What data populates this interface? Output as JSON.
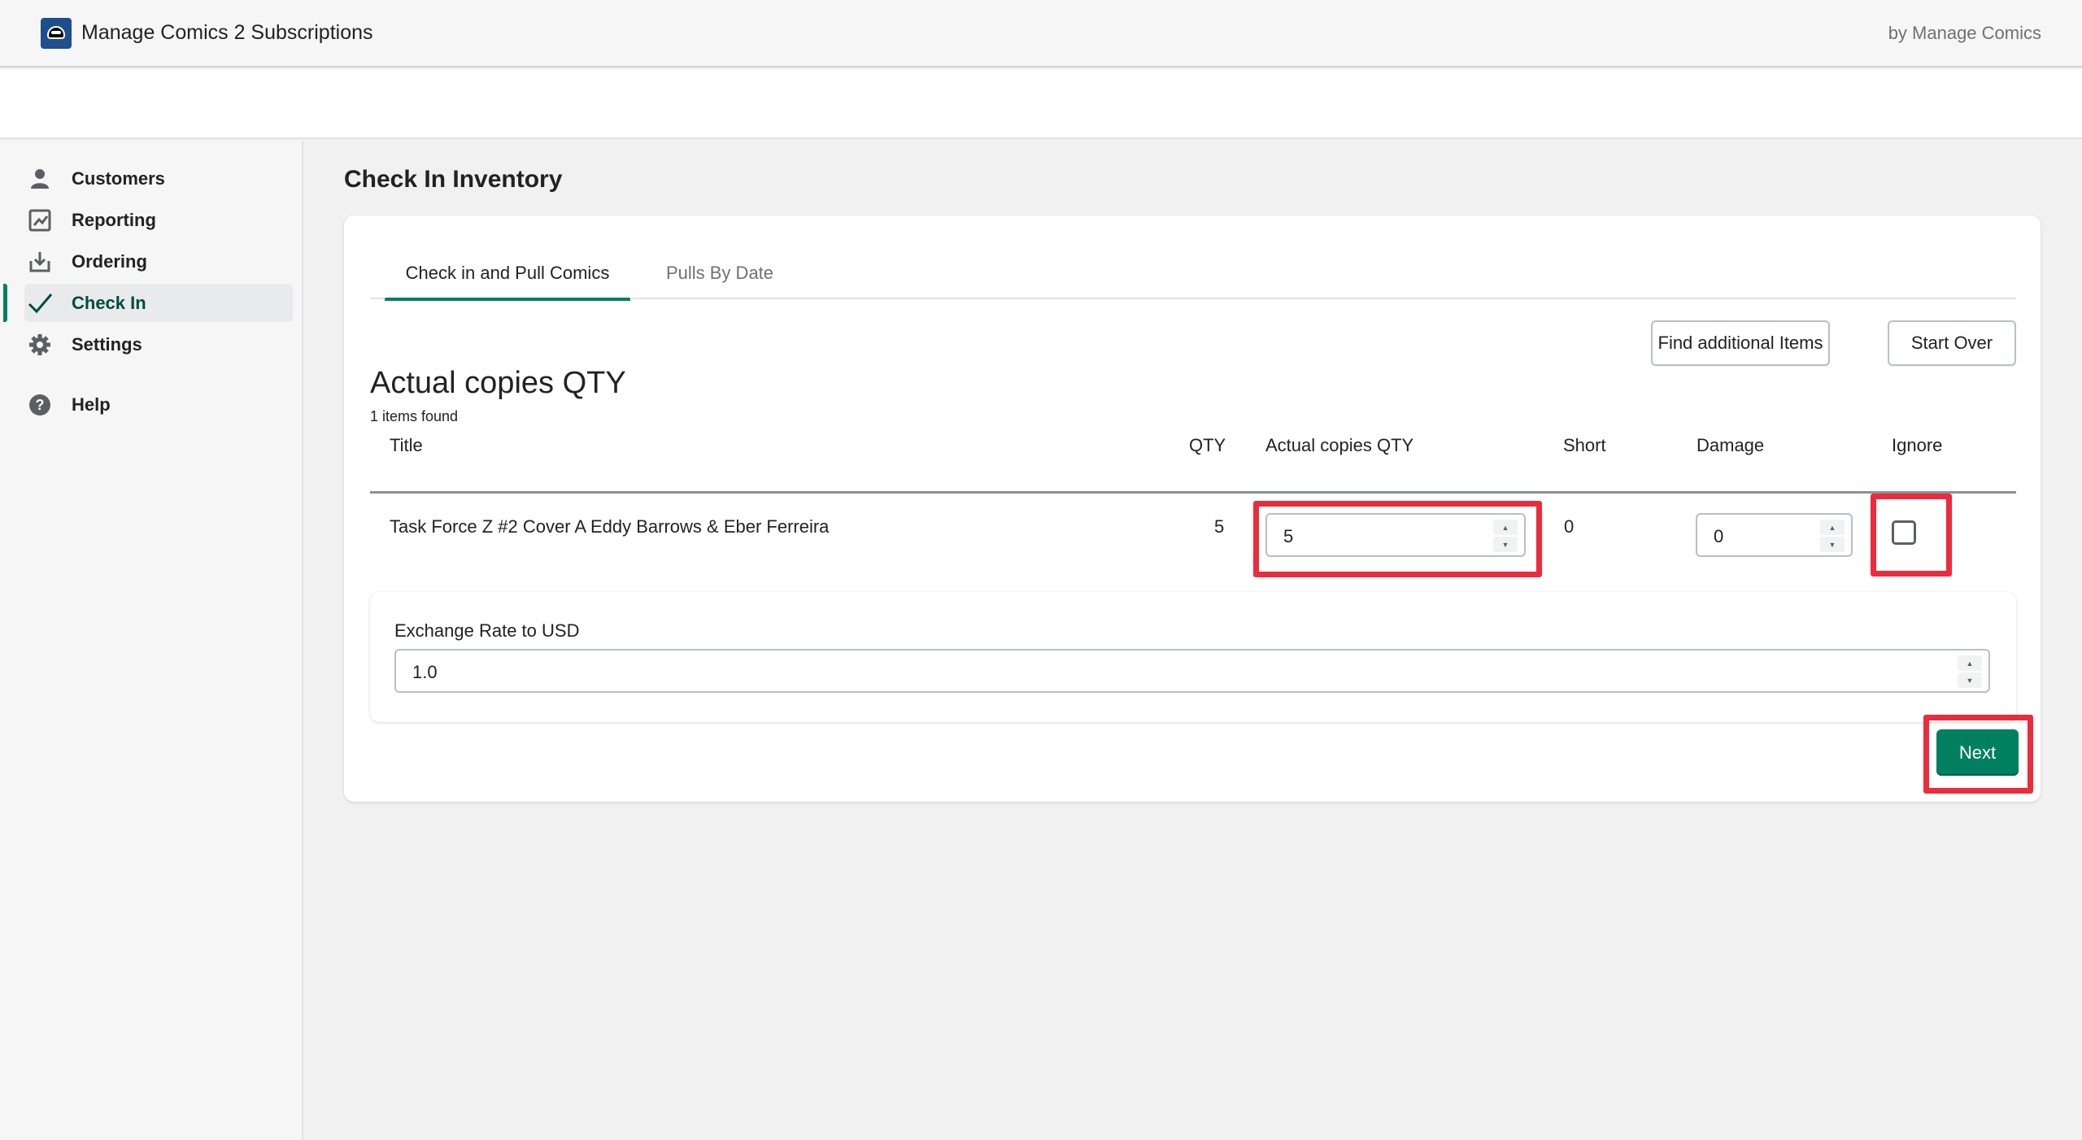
{
  "header": {
    "app_title": "Manage Comics 2 Subscriptions",
    "by_label": "by Manage Comics",
    "icon": "comic-mask-icon"
  },
  "sidebar": {
    "items": [
      {
        "label": "Customers",
        "icon": "person-icon"
      },
      {
        "label": "Reporting",
        "icon": "reporting-icon"
      },
      {
        "label": "Ordering",
        "icon": "download-tray-icon"
      },
      {
        "label": "Check In",
        "icon": "checkmark-icon",
        "active": true
      },
      {
        "label": "Settings",
        "icon": "gear-icon"
      },
      {
        "label": "Help",
        "icon": "question-circle-icon"
      }
    ]
  },
  "page": {
    "title": "Check In Inventory"
  },
  "tabs": [
    {
      "label": "Check in and Pull Comics",
      "active": true
    },
    {
      "label": "Pulls By Date",
      "active": false
    }
  ],
  "actions": {
    "find_label": "Find additional Items",
    "start_over_label": "Start Over",
    "next_label": "Next"
  },
  "section": {
    "title": "Actual copies QTY",
    "items_found": "1 items found"
  },
  "table": {
    "columns": [
      "Title",
      "QTY",
      "Actual copies QTY",
      "Short",
      "Damage",
      "Ignore"
    ],
    "rows": [
      {
        "title": "Task Force Z #2 Cover A Eddy Barrows & Eber Ferreira",
        "qty": "5",
        "actual_qty": "5",
        "short": "0",
        "damage": "0",
        "ignore": false
      }
    ]
  },
  "exchange": {
    "label": "Exchange Rate to USD",
    "value": "1.0"
  },
  "colors": {
    "primary": "#008060",
    "highlight": "#ec2b3d",
    "app_icon_bg": "#1e4e8c"
  }
}
